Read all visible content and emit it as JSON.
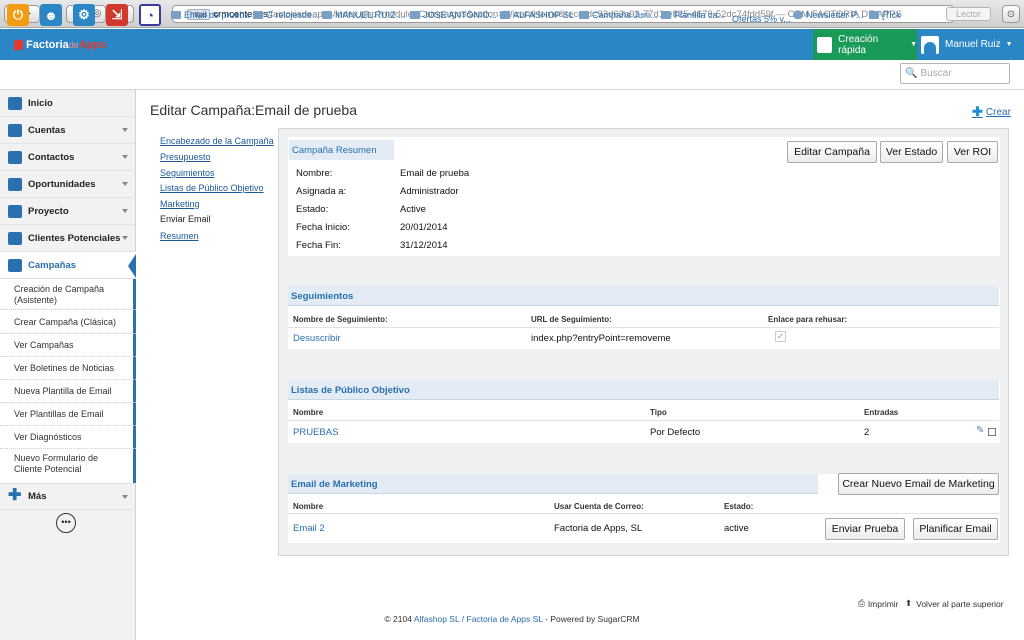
{
  "browser": {
    "https_badge": "https",
    "url_host": "crmcenter.es",
    "url_path": "/factoriadeapps/index.php?module=Campaigns&action=WizardHome&record=93d63a93-77d1-e825-4679-52dc74fdd59f",
    "window_title": "— CRM FACTORIA DE APPS",
    "reader_label": "Lector"
  },
  "header": {
    "logo_a": "Factoria",
    "logo_b": "de",
    "logo_c": "Apps",
    "quick_create": "Creación rápida",
    "user_name": "Manuel Ruiz"
  },
  "recent": [
    "Email de prueba",
    "G relojesde...",
    "MANUEL RUIZ ...",
    "JOSE ANTONIO...",
    "ALFASHOP SL",
    "Campaña Juni...",
    "Plantilla ca...",
    "Ofertas 5% v...",
    "Newsletter P...",
    "[Tick"
  ],
  "search": {
    "placeholder": "Buscar"
  },
  "sidebar": {
    "items": [
      "Inicio",
      "Cuentas",
      "Contactos",
      "Oportunidades",
      "Proyecto",
      "Clientes Potenciales",
      "Campañas",
      "Más"
    ],
    "subitems": [
      "Creación de Campaña (Asistente)",
      "Crear Campaña (Clásica)",
      "Ver Campañas",
      "Ver Boletines de Noticias",
      "Nueva Plantilla de Email",
      "Ver Plantillas de Email",
      "Ver Diagnósticos",
      "Nuevo Formulario de Cliente Potencial"
    ]
  },
  "page": {
    "title": "Editar Campaña:Email de prueba",
    "create_link": "Crear"
  },
  "wizard_nav": [
    "Encabezado de la Campaña",
    "Presupuesto",
    "Seguimientos",
    "Listas de Público Objetivo",
    "Marketing",
    "Enviar Email",
    "Resumen"
  ],
  "summary": {
    "tab": "Campaña Resumen",
    "buttons": [
      "Editar Campaña",
      "Ver Estado",
      "Ver ROI"
    ],
    "fields": [
      {
        "label": "Nombre:",
        "value": "Email de prueba"
      },
      {
        "label": "Asignada a:",
        "value": "Administrador"
      },
      {
        "label": "Estado:",
        "value": "Active"
      },
      {
        "label": "Fecha Inicio:",
        "value": "20/01/2014"
      },
      {
        "label": "Fecha Fin:",
        "value": "31/12/2014"
      }
    ]
  },
  "tracking": {
    "title": "Seguimientos",
    "columns": [
      "Nombre de Seguimiento:",
      "URL de Seguimiento:",
      "Enlace para rehusar:"
    ],
    "row": {
      "name": "Desuscribir",
      "url": "index.php?entryPoint=removeme",
      "check": "✓"
    }
  },
  "lists": {
    "title": "Listas de Público Objetivo",
    "columns": [
      "Nombre",
      "Tipo",
      "Entradas"
    ],
    "row": {
      "name": "PRUEBAS",
      "type": "Por Defecto",
      "entries": "2"
    }
  },
  "email": {
    "title": "Email de Marketing",
    "new_button": "Crear Nuevo Email de Marketing",
    "columns": [
      "Nombre",
      "Usar Cuenta de Correo:",
      "Estado:"
    ],
    "row": {
      "name": "Email 2",
      "account": "Factoria de Apps, SL",
      "status": "active"
    },
    "buttons": [
      "Enviar Prueba",
      "Planificar Email"
    ]
  },
  "footer": {
    "print": "Imprimir",
    "back_top": "Volver al parte superior",
    "copyright_pre": "© 2104",
    "company_a": "Alfashop SL",
    "sep": "/",
    "company_b": "Factoria de Apps SL",
    "powered": "- Powered by SugarCRM"
  },
  "colors": {
    "accent": "#2a86c5",
    "quick": "#1a9a58",
    "link": "#2a6fb0"
  }
}
